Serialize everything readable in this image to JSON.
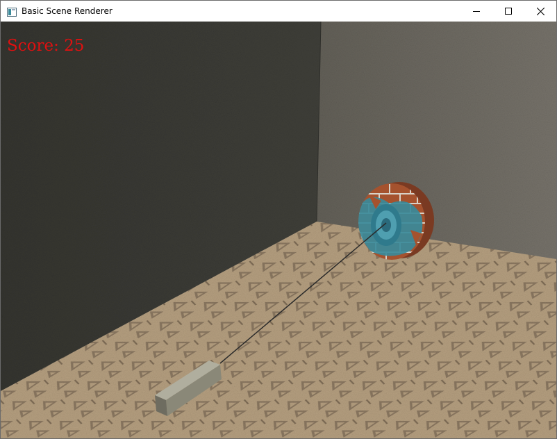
{
  "window": {
    "title": "Basic Scene Renderer",
    "controls": {
      "minimize_icon": "minimize-icon",
      "maximize_icon": "maximize-icon",
      "close_icon": "close-icon"
    }
  },
  "hud": {
    "score_text": "Score: 25",
    "score_color": "#e01010"
  },
  "scene": {
    "colors": {
      "left_wall": "#3b3b36",
      "back_wall": "#6f6b62",
      "floor": "#b49e7f",
      "floor_pattern": "#8a7760",
      "target_brick": "#a5522e",
      "target_blue": "#3a8a9a",
      "block": "#8a8878",
      "rope": "#2a2a2a"
    }
  }
}
